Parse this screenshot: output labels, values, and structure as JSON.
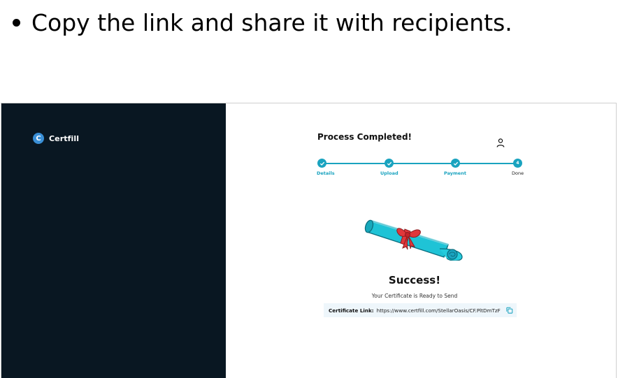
{
  "caption": {
    "text": "Copy the link and share it with recipients."
  },
  "sidebar": {
    "brand_initial": "C",
    "brand_name": "Certfill"
  },
  "header": {
    "title": "Process Completed!",
    "user_icon": "user-icon"
  },
  "stepper": {
    "steps": [
      {
        "label": "Details",
        "state": "complete"
      },
      {
        "label": "Upload",
        "state": "complete"
      },
      {
        "label": "Payment",
        "state": "complete"
      },
      {
        "label": "Done",
        "state": "current",
        "number": "4"
      }
    ]
  },
  "main": {
    "illustration": "certificate-scroll-illustration",
    "success_title": "Success!",
    "subtitle": "Your Certificate is Ready to Send",
    "link_label": "Certificate Link:",
    "link_url": "https://www.certfill.com/StellarOasis/CF.PltDmTzF",
    "copy_icon": "copy-icon"
  },
  "colors": {
    "accent": "#1aa3bf",
    "sidebar_bg": "#091722",
    "link_bg": "#eef6fb",
    "ribbon": "#e0373b"
  }
}
